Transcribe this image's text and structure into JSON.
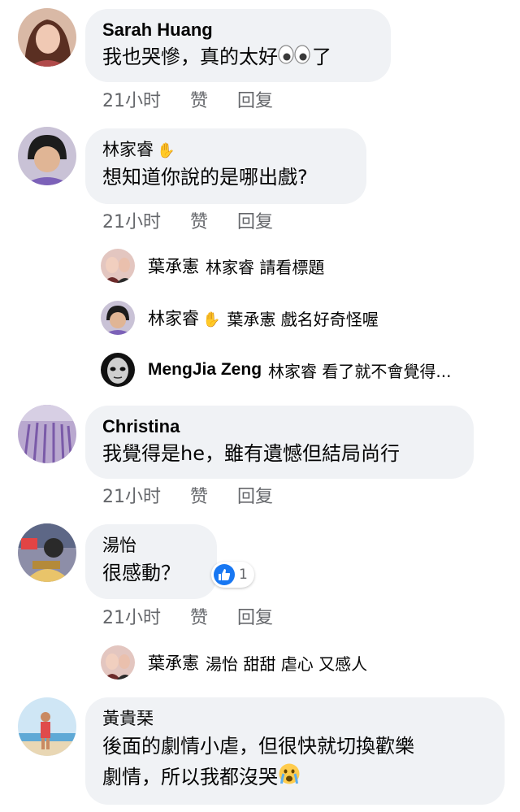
{
  "comments": [
    {
      "author": "Sarah Huang",
      "text": "我也哭慘，真的太好",
      "text_suffix": "了",
      "time": "21小时",
      "like": "赞",
      "reply": "回复"
    },
    {
      "author": "林家睿",
      "text": "想知道你說的是哪出戲?",
      "time": "21小时",
      "like": "赞",
      "reply": "回复",
      "replies": [
        {
          "author": "葉承憲",
          "text": "林家睿 請看標題"
        },
        {
          "author": "林家睿",
          "text": "葉承憲 戲名好奇怪喔"
        },
        {
          "author": "MengJia Zeng",
          "text": "林家睿 看了就不會覺得..."
        }
      ]
    },
    {
      "author": "Christina",
      "text": "我覺得是he，雖有遺憾但結局尚行",
      "time": "21小时",
      "like": "赞",
      "reply": "回复"
    },
    {
      "author": "湯怡",
      "text": "很感動？",
      "reaction_count": "1",
      "time": "21小时",
      "like": "赞",
      "reply": "回复",
      "replies": [
        {
          "author": "葉承憲",
          "text": "湯怡 甜甜 虐心 又感人"
        }
      ]
    },
    {
      "author": "黃貴琹",
      "text_line1": "後面的劇情小虐，但很快就切換歡樂",
      "text_line2": "劇情，所以我都沒哭"
    }
  ],
  "colors": {
    "bubble": "#f0f2f5",
    "meta": "#65676b",
    "like_blue": "#1877f2"
  },
  "icons": [
    "waving-hand-icon",
    "eyes-emoji-icon",
    "crying-emoji-icon",
    "like-thumb-icon"
  ]
}
